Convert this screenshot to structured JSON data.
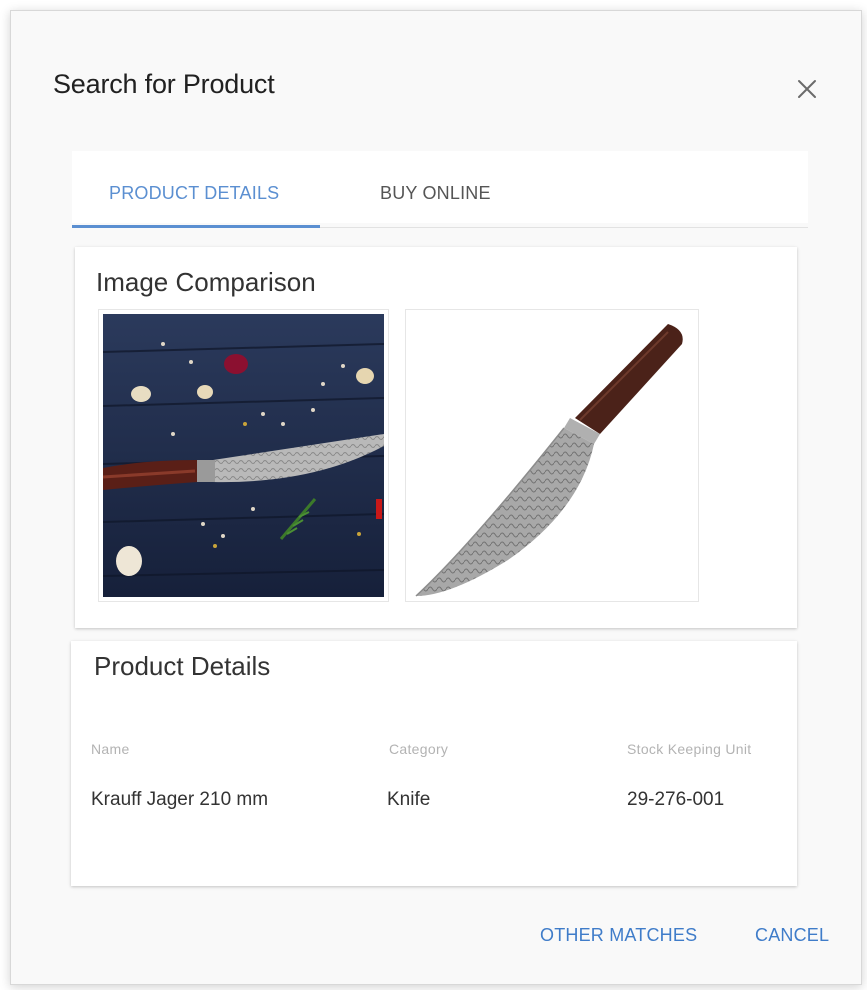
{
  "dialog": {
    "title": "Search for Product",
    "close_icon": "close-icon"
  },
  "tabs": [
    {
      "label": "PRODUCT DETAILS",
      "active": true
    },
    {
      "label": "BUY ONLINE",
      "active": false
    }
  ],
  "image_comparison": {
    "heading": "Image Comparison",
    "images": [
      "knife-on-table-photo",
      "knife-product-photo"
    ]
  },
  "product_details": {
    "heading": "Product Details",
    "columns": [
      "Name",
      "Category",
      "Stock Keeping Unit"
    ],
    "row": [
      "Krauff Jager 210 mm",
      "Knife",
      "29-276-001"
    ]
  },
  "actions": {
    "other_matches": "OTHER MATCHES",
    "cancel": "CANCEL"
  },
  "colors": {
    "accent": "#5b8fd1",
    "button_text": "#3f7cc9"
  }
}
